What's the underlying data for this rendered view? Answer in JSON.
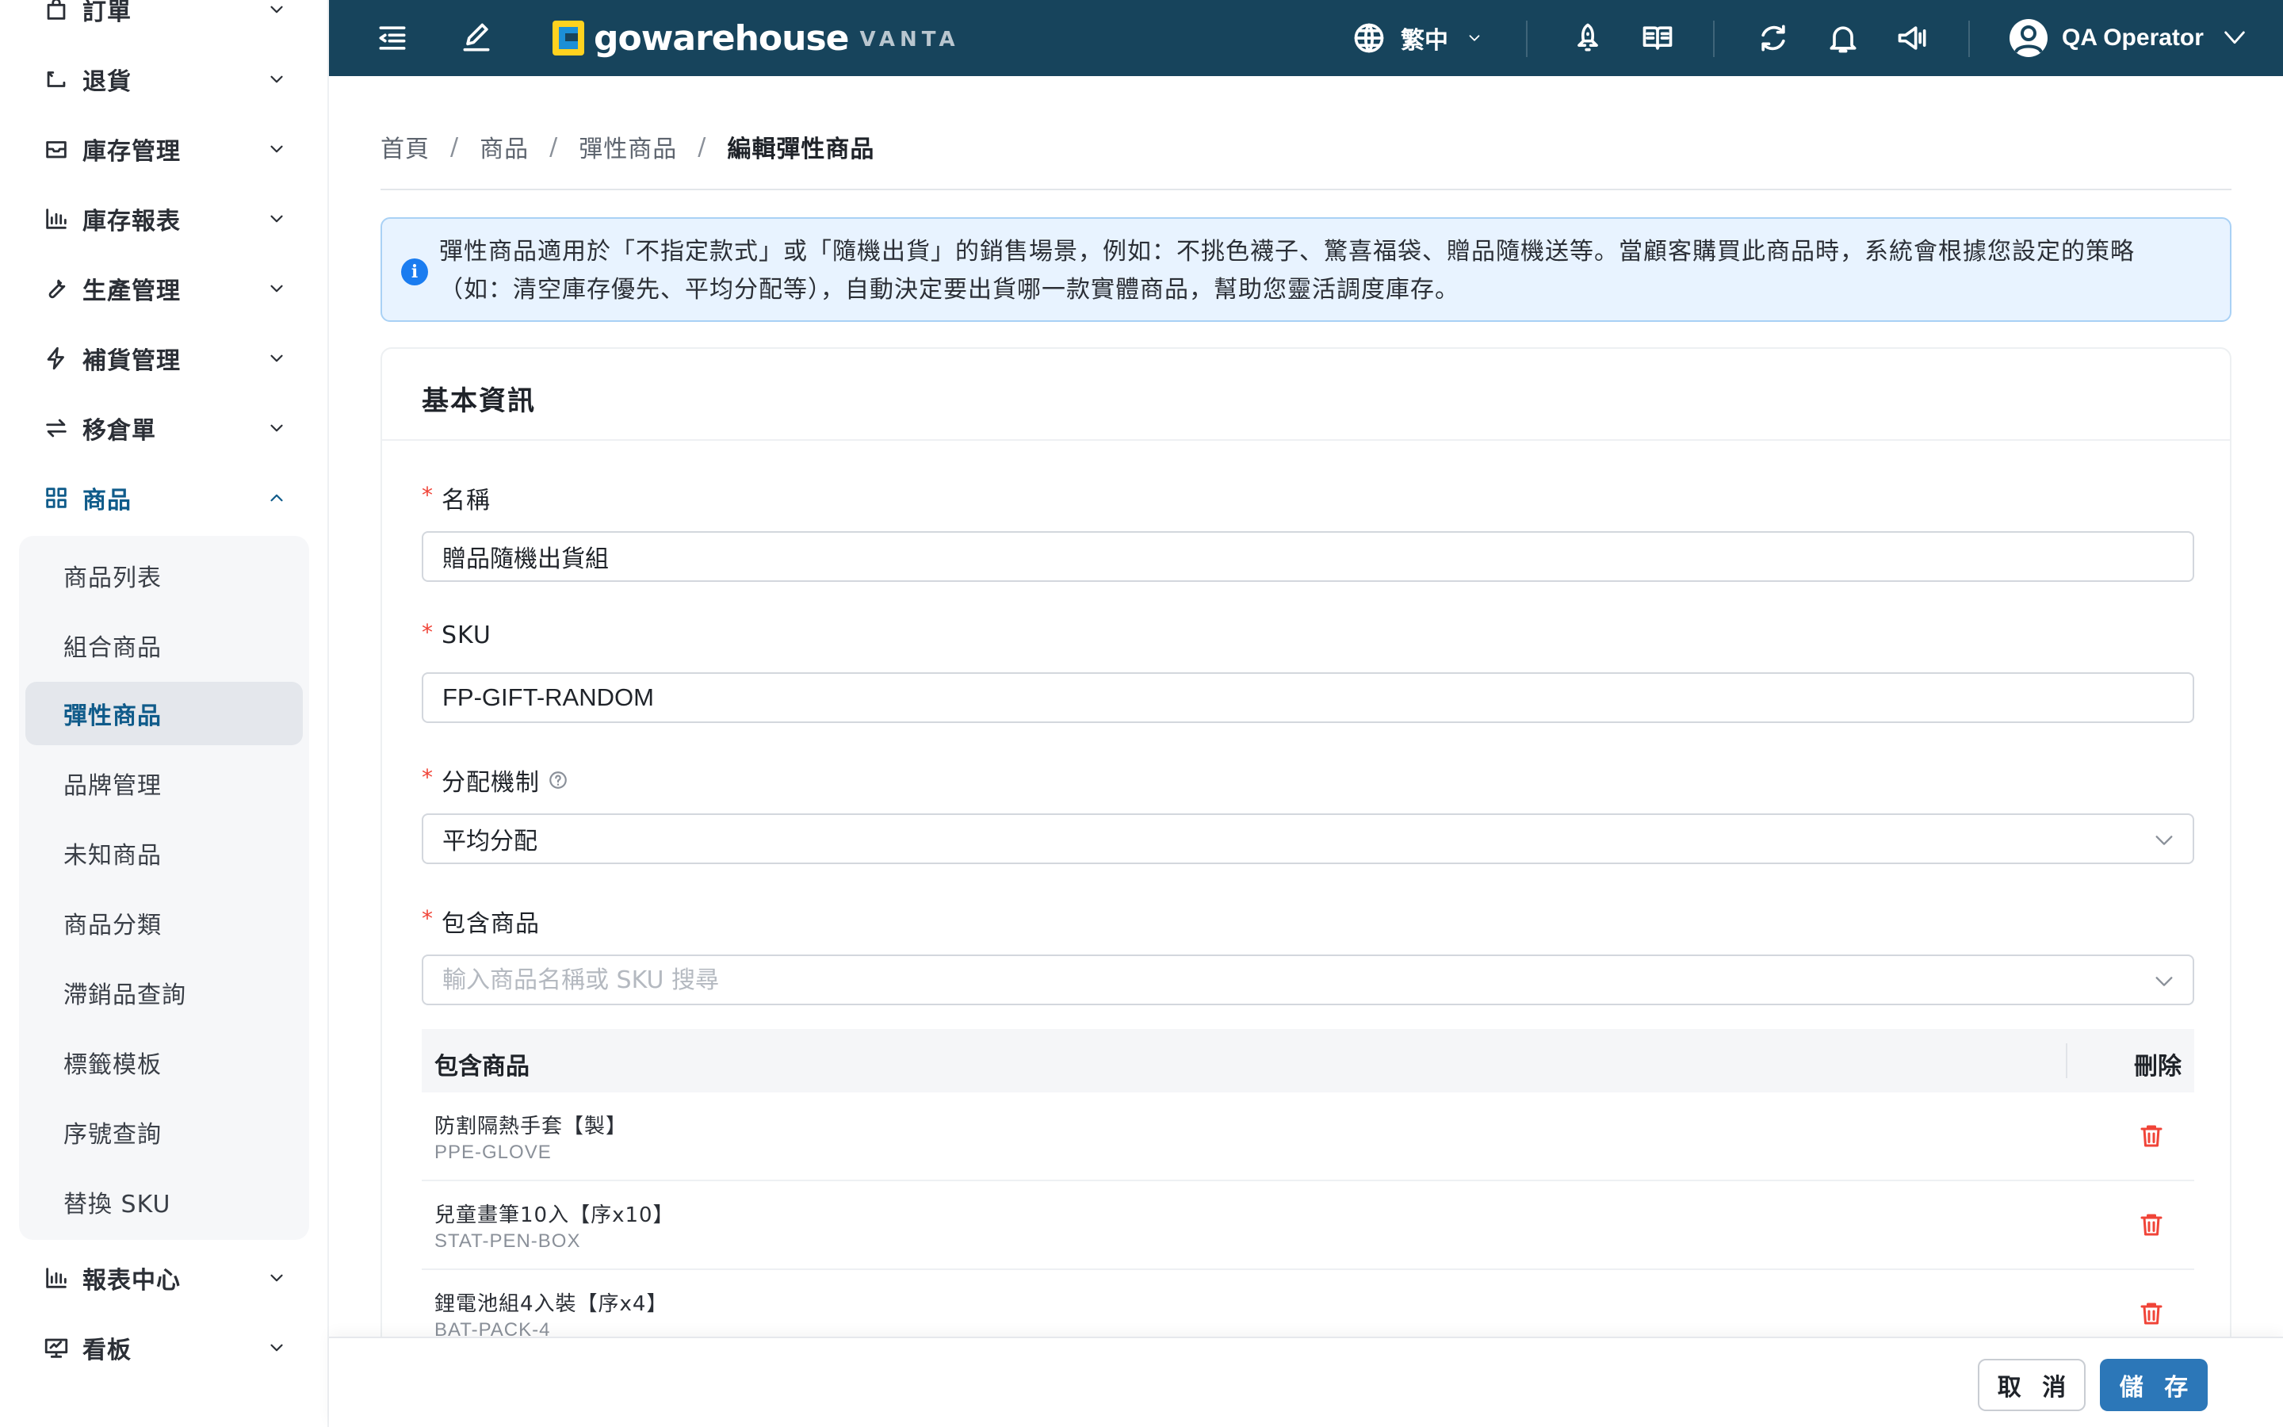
{
  "sidebar": {
    "items": [
      {
        "label": "訂單",
        "icon": "shopping-bag-icon",
        "expanded": false
      },
      {
        "label": "退貨",
        "icon": "return-icon",
        "expanded": false
      },
      {
        "label": "庫存管理",
        "icon": "inbox-icon",
        "expanded": false
      },
      {
        "label": "庫存報表",
        "icon": "bar-chart-icon",
        "expanded": false
      },
      {
        "label": "生產管理",
        "icon": "wrench-icon",
        "expanded": false
      },
      {
        "label": "補貨管理",
        "icon": "lightning-icon",
        "expanded": false
      },
      {
        "label": "移倉單",
        "icon": "transfer-icon",
        "expanded": false
      },
      {
        "label": "商品",
        "icon": "grid-icon",
        "expanded": true,
        "active": true
      },
      {
        "label": "報表中心",
        "icon": "bar-chart-icon",
        "expanded": false
      },
      {
        "label": "看板",
        "icon": "dashboard-icon",
        "expanded": false
      }
    ],
    "product_submenu": [
      {
        "label": "商品列表"
      },
      {
        "label": "組合商品"
      },
      {
        "label": "彈性商品",
        "active": true
      },
      {
        "label": "品牌管理"
      },
      {
        "label": "未知商品"
      },
      {
        "label": "商品分類"
      },
      {
        "label": "滯銷品查詢"
      },
      {
        "label": "標籤模板"
      },
      {
        "label": "序號查詢"
      },
      {
        "label": "替換 SKU"
      }
    ]
  },
  "topbar": {
    "logo_text": "gowarehouse",
    "logo_sub": "VANTA",
    "language": "繁中",
    "user_name": "QA Operator",
    "icons": [
      "menu-fold-icon",
      "edit-icon",
      "globe-icon",
      "rocket-icon",
      "book-icon",
      "refresh-icon",
      "bell-icon",
      "megaphone-icon",
      "user-icon"
    ]
  },
  "breadcrumb": [
    "首頁",
    "商品",
    "彈性商品",
    "編輯彈性商品"
  ],
  "alert": {
    "text": "彈性商品適用於「不指定款式」或「隨機出貨」的銷售場景，例如：不挑色襪子、驚喜福袋、贈品隨機送等。當顧客購買此商品時，系統會根據您設定的策略（如：清空庫存優先、平均分配等），自動決定要出貨哪一款實體商品，幫助您靈活調度庫存。"
  },
  "form": {
    "section_title": "基本資訊",
    "name": {
      "label": "名稱",
      "value": "贈品隨機出貨組"
    },
    "sku": {
      "label": "SKU",
      "value": "FP-GIFT-RANDOM"
    },
    "allocation": {
      "label": "分配機制",
      "value": "平均分配"
    },
    "included": {
      "label": "包含商品",
      "placeholder": "輸入商品名稱或 SKU 搜尋"
    }
  },
  "table": {
    "col_name": "包含商品",
    "col_delete": "刪除",
    "rows": [
      {
        "name": "防割隔熱手套【製】",
        "sku": "PPE-GLOVE"
      },
      {
        "name": "兒童畫筆10入【序x10】",
        "sku": "STAT-PEN-BOX"
      },
      {
        "name": "鋰電池組4入裝【序x4】",
        "sku": "BAT-PACK-4"
      }
    ]
  },
  "footer": {
    "cancel": "取 消",
    "save": "儲 存"
  },
  "colors": {
    "topbar": "#17445c",
    "primary": "#2c77b8",
    "active_text": "#0f5b8a",
    "danger": "#f04438",
    "alert_bg": "#e8f3ff"
  }
}
